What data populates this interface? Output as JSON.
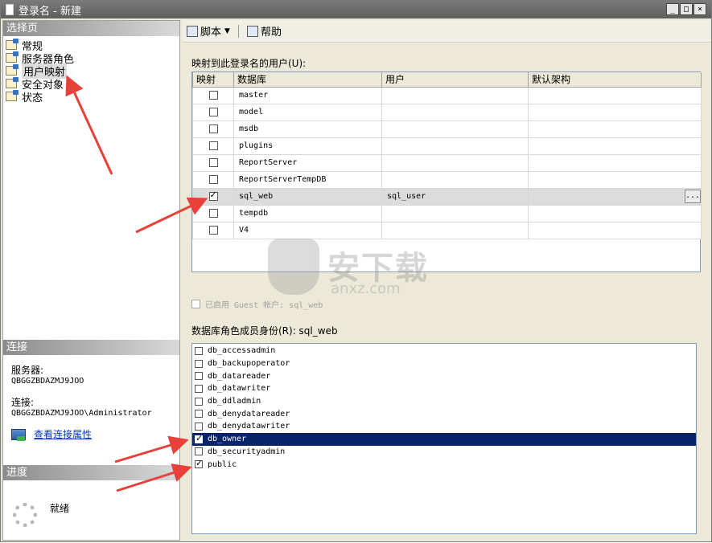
{
  "window": {
    "title": "登录名 - 新建",
    "controls": [
      "_",
      "□",
      "×"
    ]
  },
  "left": {
    "select_page_header": "选择页",
    "nav": [
      {
        "label": "常规",
        "icon": "page-icon"
      },
      {
        "label": "服务器角色",
        "icon": "page-icon"
      },
      {
        "label": "用户映射",
        "icon": "page-icon",
        "selected": true
      },
      {
        "label": "安全对象",
        "icon": "page-icon"
      },
      {
        "label": "状态",
        "icon": "page-icon"
      }
    ],
    "connection": {
      "header": "连接",
      "server_label": "服务器:",
      "server_value": "QBGGZBDAZMJ9JOO",
      "conn_label": "连接:",
      "conn_value": "QBGGZBDAZMJ9JOO\\Administrator",
      "view_props_link": "查看连接属性"
    },
    "progress": {
      "header": "进度",
      "status": "就绪"
    }
  },
  "toolbar": {
    "script_label": "脚本",
    "help_label": "帮助"
  },
  "mapping": {
    "title": "映射到此登录名的用户(U):",
    "columns": [
      "映射",
      "数据库",
      "用户",
      "默认架构"
    ],
    "rows": [
      {
        "mapped": false,
        "db": "master",
        "user": "",
        "schema": ""
      },
      {
        "mapped": false,
        "db": "model",
        "user": "",
        "schema": ""
      },
      {
        "mapped": false,
        "db": "msdb",
        "user": "",
        "schema": ""
      },
      {
        "mapped": false,
        "db": "plugins",
        "user": "",
        "schema": ""
      },
      {
        "mapped": false,
        "db": "ReportServer",
        "user": "",
        "schema": ""
      },
      {
        "mapped": false,
        "db": "ReportServerTempDB",
        "user": "",
        "schema": ""
      },
      {
        "mapped": true,
        "db": "sql_web",
        "user": "sql_user",
        "schema": "",
        "highlight": true,
        "ellipsis": "..."
      },
      {
        "mapped": false,
        "db": "tempdb",
        "user": "",
        "schema": ""
      },
      {
        "mapped": false,
        "db": "V4",
        "user": "",
        "schema": ""
      }
    ]
  },
  "guest": {
    "label": "已启用 Guest 帐户: sql_web"
  },
  "roles": {
    "title": "数据库角色成员身份(R): sql_web",
    "items": [
      {
        "name": "db_accessadmin",
        "checked": false
      },
      {
        "name": "db_backupoperator",
        "checked": false
      },
      {
        "name": "db_datareader",
        "checked": false
      },
      {
        "name": "db_datawriter",
        "checked": false
      },
      {
        "name": "db_ddladmin",
        "checked": false
      },
      {
        "name": "db_denydatareader",
        "checked": false
      },
      {
        "name": "db_denydatawriter",
        "checked": false
      },
      {
        "name": "db_owner",
        "checked": true,
        "selected": true
      },
      {
        "name": "db_securityadmin",
        "checked": false
      },
      {
        "name": "public",
        "checked": true
      }
    ]
  },
  "watermark": {
    "text": "安下载",
    "url": "anxz.com"
  },
  "colors": {
    "selection": "#0a246a",
    "annotation_arrow": "#e8403a",
    "link": "#0033cc"
  }
}
